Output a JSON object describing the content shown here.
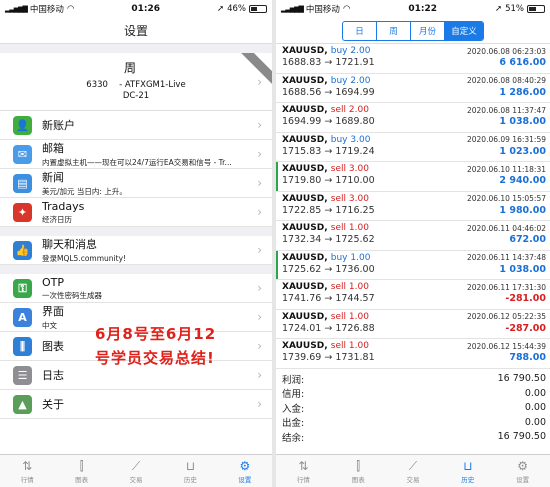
{
  "left": {
    "status": {
      "carrier": "中国移动",
      "time": "01:26",
      "battery": "46%",
      "battery_level": 0.46
    },
    "title": "设置",
    "account": {
      "name": "周  ",
      "server": "6330   - ATFXGM1-Live",
      "sub": "DC-21"
    },
    "rows": [
      {
        "title": "新账户",
        "subtitle": ""
      },
      {
        "title": "邮箱",
        "subtitle": "内置虚拟主机——现在可以24/7运行EA交易和信号 - Tr..."
      },
      {
        "title": "新闻",
        "subtitle": "美元/加元 当日内: 上升。"
      },
      {
        "title": "Tradays",
        "subtitle": "经济日历"
      },
      {
        "title": "聊天和消息",
        "subtitle": "登录MQL5.community!"
      },
      {
        "title": "OTP",
        "subtitle": "一次性密码生成器"
      },
      {
        "title": "界面",
        "subtitle": "中文"
      },
      {
        "title": "图表",
        "subtitle": ""
      },
      {
        "title": "日志",
        "subtitle": ""
      },
      {
        "title": "关于",
        "subtitle": ""
      }
    ],
    "overlay": {
      "line1": "6月8号至6月12",
      "line2": "号学员交易总结!"
    },
    "tabs": [
      "行情",
      "图表",
      "交易",
      "历史",
      "设置"
    ]
  },
  "right": {
    "status": {
      "carrier": "中国移动",
      "time": "01:22",
      "battery": "51%",
      "battery_level": 0.51
    },
    "segments": [
      "日",
      "周",
      "月份",
      "自定义"
    ],
    "deals": [
      {
        "symbol": "XAUUSD,",
        "side": "buy",
        "lots": "2.00",
        "time": "2020.06.08 06:23:03",
        "open": "1688.83",
        "close": "1721.91",
        "profit": "6 616.00",
        "positive": true,
        "marked": false
      },
      {
        "symbol": "XAUUSD,",
        "side": "buy",
        "lots": "2.00",
        "time": "2020.06.08 08:40:29",
        "open": "1688.56",
        "close": "1694.99",
        "profit": "1 286.00",
        "positive": true,
        "marked": false
      },
      {
        "symbol": "XAUUSD,",
        "side": "sell",
        "lots": "2.00",
        "time": "2020.06.08 11:37:47",
        "open": "1694.99",
        "close": "1689.80",
        "profit": "1 038.00",
        "positive": true,
        "marked": false
      },
      {
        "symbol": "XAUUSD,",
        "side": "buy",
        "lots": "3.00",
        "time": "2020.06.09 16:31:59",
        "open": "1715.83",
        "close": "1719.24",
        "profit": "1 023.00",
        "positive": true,
        "marked": false
      },
      {
        "symbol": "XAUUSD,",
        "side": "sell",
        "lots": "3.00",
        "time": "2020.06.10 11:18:31",
        "open": "1719.80",
        "close": "1710.00",
        "profit": "2 940.00",
        "positive": true,
        "marked": true
      },
      {
        "symbol": "XAUUSD,",
        "side": "sell",
        "lots": "3.00",
        "time": "2020.06.10 15:05:57",
        "open": "1722.85",
        "close": "1716.25",
        "profit": "1 980.00",
        "positive": true,
        "marked": false
      },
      {
        "symbol": "XAUUSD,",
        "side": "sell",
        "lots": "1.00",
        "time": "2020.06.11 04:46:02",
        "open": "1732.34",
        "close": "1725.62",
        "profit": "672.00",
        "positive": true,
        "marked": false
      },
      {
        "symbol": "XAUUSD,",
        "side": "buy",
        "lots": "1.00",
        "time": "2020.06.11 14:37:48",
        "open": "1725.62",
        "close": "1736.00",
        "profit": "1 038.00",
        "positive": true,
        "marked": true
      },
      {
        "symbol": "XAUUSD,",
        "side": "sell",
        "lots": "1.00",
        "time": "2020.06.11 17:31:30",
        "open": "1741.76",
        "close": "1744.57",
        "profit": "-281.00",
        "positive": false,
        "marked": false
      },
      {
        "symbol": "XAUUSD,",
        "side": "sell",
        "lots": "1.00",
        "time": "2020.06.12 05:22:35",
        "open": "1724.01",
        "close": "1726.88",
        "profit": "-287.00",
        "positive": false,
        "marked": false
      },
      {
        "symbol": "XAUUSD,",
        "side": "sell",
        "lots": "1.00",
        "time": "2020.06.12 15:44:39",
        "open": "1739.69",
        "close": "1731.81",
        "profit": "788.00",
        "positive": true,
        "marked": false
      }
    ],
    "summary": [
      {
        "label": "利润:",
        "value": "16 790.50"
      },
      {
        "label": "信用:",
        "value": "0.00"
      },
      {
        "label": "入金:",
        "value": "0.00"
      },
      {
        "label": "出金:",
        "value": "0.00"
      },
      {
        "label": "结余:",
        "value": "16 790.50"
      }
    ],
    "tabs": [
      "行情",
      "图表",
      "交易",
      "历史",
      "设置"
    ]
  },
  "colors": {
    "accent": "#1a7ae6",
    "buy": "#1a6fd6",
    "sell": "#d62020",
    "overlay": "#e0201a"
  },
  "icons": {
    "rows": [
      "add-user-icon",
      "mail-icon",
      "news-icon",
      "tradays-icon",
      "chat-icon",
      "otp-key-icon",
      "language-icon",
      "chart-settings-icon",
      "journal-icon",
      "about-icon"
    ],
    "tabs": [
      "quotes-icon",
      "candles-icon",
      "trade-icon",
      "history-icon",
      "gear-icon"
    ]
  }
}
